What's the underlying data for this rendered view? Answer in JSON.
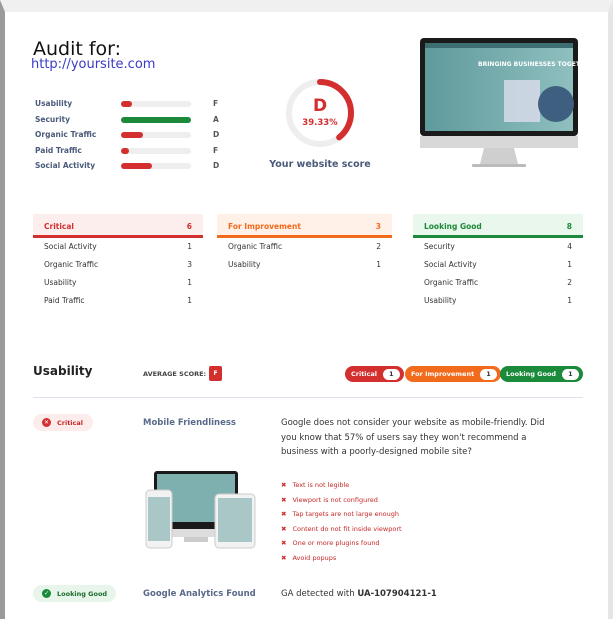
{
  "header": {
    "title": "Audit for:",
    "url": "http://yoursite.com"
  },
  "metrics": [
    {
      "label": "Usability",
      "grade": "F",
      "percent": 15,
      "color": "#d32f2f"
    },
    {
      "label": "Security",
      "grade": "A",
      "percent": 100,
      "color": "#1b8a3a"
    },
    {
      "label": "Organic Traffic",
      "grade": "D",
      "percent": 31,
      "color": "#d32f2f"
    },
    {
      "label": "Paid Traffic",
      "grade": "F",
      "percent": 12,
      "color": "#d32f2f"
    },
    {
      "label": "Social Activity",
      "grade": "D",
      "percent": 44,
      "color": "#d32f2f"
    }
  ],
  "score": {
    "grade": "D",
    "percent_text": "39.33%",
    "value": 39.33,
    "caption": "Your website score",
    "color": "#d32f2f"
  },
  "categories": [
    {
      "title": "Critical",
      "count": "6",
      "color": "#d32f2f",
      "bg": "#fdeeee",
      "items": [
        {
          "label": "Social Activity",
          "count": "1"
        },
        {
          "label": "Organic Traffic",
          "count": "3"
        },
        {
          "label": "Usability",
          "count": "1"
        },
        {
          "label": "Paid Traffic",
          "count": "1"
        }
      ]
    },
    {
      "title": "For Improvement",
      "count": "3",
      "color": "#f26a1b",
      "bg": "#fff1e8",
      "items": [
        {
          "label": "Organic Traffic",
          "count": "2"
        },
        {
          "label": "Usability",
          "count": "1"
        }
      ]
    },
    {
      "title": "Looking Good",
      "count": "8",
      "color": "#1b8a3a",
      "bg": "#eaf7ec",
      "items": [
        {
          "label": "Security",
          "count": "4"
        },
        {
          "label": "Social Activity",
          "count": "1"
        },
        {
          "label": "Organic Traffic",
          "count": "2"
        },
        {
          "label": "Usability",
          "count": "1"
        }
      ]
    }
  ],
  "section": {
    "title": "Usability",
    "avg_label": "AVERAGE SCORE:",
    "avg_grade": "F",
    "pills": [
      {
        "label": "Critical",
        "count": "1",
        "color": "#d32f2f"
      },
      {
        "label": "For Improvement",
        "count": "1",
        "color": "#f26a1b"
      },
      {
        "label": "Looking Good",
        "count": "1",
        "color": "#1b8a3a"
      }
    ]
  },
  "checks": [
    {
      "status": "Critical",
      "name": "Mobile Friendliness",
      "description": "Google does not consider your website as mobile-friendly. Did you know that 57% of users say they won't recommend a business with a poorly-designed mobile site?",
      "failures": [
        "Text is not legible",
        "Viewport is not configured",
        "Tap targets are not large enough",
        "Content do not fit inside viewport",
        "One or more plugins found",
        "Avoid popups"
      ]
    },
    {
      "status": "Looking Good",
      "name": "Google Analytics Found",
      "description_prefix": "GA detected with ",
      "description_id": "UA-107904121-1"
    }
  ]
}
